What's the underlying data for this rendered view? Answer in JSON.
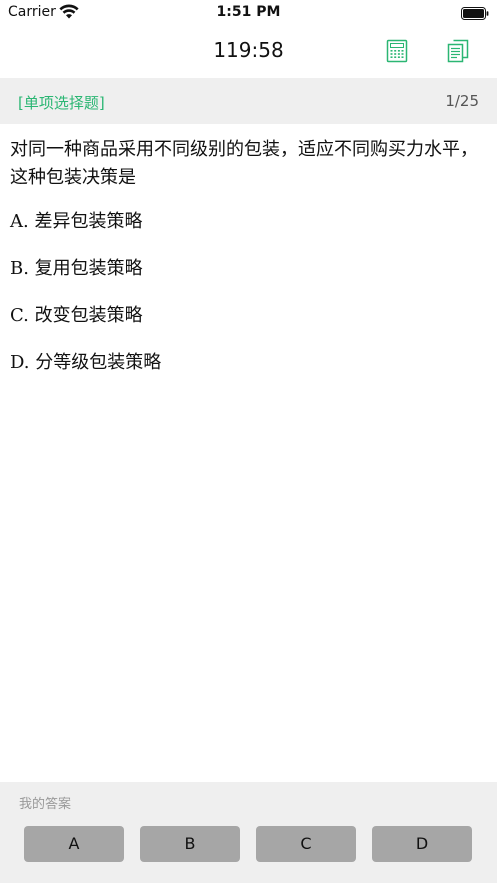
{
  "status_bar": {
    "carrier": "Carrier",
    "time": "1:51 PM",
    "icons": [
      "wifi-icon",
      "battery-icon"
    ]
  },
  "header": {
    "timer": "119:58",
    "icons": [
      "calculator-icon",
      "answer-sheet-icon"
    ],
    "accent_color": "#2bb673"
  },
  "question_bar": {
    "type": "[单项选择题]",
    "progress": "1/25"
  },
  "question": {
    "text": "对同一种商品采用不同级别的包装，适应不同购买力水平，这种包装决策是",
    "options": [
      {
        "letter": "A.",
        "text": "差异包装策略"
      },
      {
        "letter": "B.",
        "text": "复用包装策略"
      },
      {
        "letter": "C.",
        "text": "改变包装策略"
      },
      {
        "letter": "D.",
        "text": "分等级包装策略"
      }
    ]
  },
  "answer_bar": {
    "caption": "我的答案",
    "buttons": [
      "A",
      "B",
      "C",
      "D"
    ]
  }
}
